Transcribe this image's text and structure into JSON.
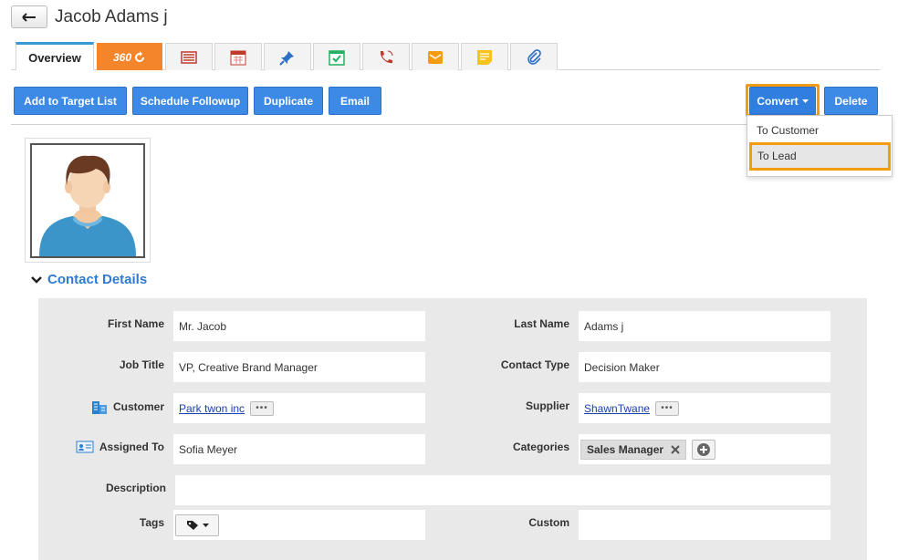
{
  "header": {
    "title": "Jacob Adams j"
  },
  "tabs": {
    "overview": "Overview",
    "t360": "360",
    "icons": [
      "invoice-icon",
      "calendar-icon",
      "pin-icon",
      "task-icon",
      "call-icon",
      "mail-icon",
      "note-icon",
      "attachment-icon"
    ]
  },
  "toolbar": {
    "add_to_target_list": "Add to Target List",
    "schedule_followup": "Schedule Followup",
    "duplicate": "Duplicate",
    "email": "Email",
    "convert": "Convert",
    "delete": "Delete"
  },
  "convert_menu": {
    "to_customer": "To Customer",
    "to_lead": "To Lead"
  },
  "section": {
    "title": "Contact Details"
  },
  "fields": {
    "first_name": {
      "label": "First Name",
      "value": "Mr. Jacob"
    },
    "last_name": {
      "label": "Last Name",
      "value": "Adams j"
    },
    "job_title": {
      "label": "Job Title",
      "value": "VP, Creative Brand Manager"
    },
    "contact_type": {
      "label": "Contact Type",
      "value": "Decision Maker"
    },
    "customer": {
      "label": "Customer",
      "value": "Park twon inc"
    },
    "supplier": {
      "label": "Supplier",
      "value": "ShawnTwane"
    },
    "assigned_to": {
      "label": "Assigned To",
      "value": "Sofia Meyer"
    },
    "categories": {
      "label": "Categories",
      "value": "Sales Manager"
    },
    "description": {
      "label": "Description",
      "value": ""
    },
    "tags": {
      "label": "Tags"
    },
    "custom": {
      "label": "Custom",
      "value": ""
    }
  },
  "colors": {
    "accent": "#3d8ae6",
    "highlight": "#f39c12",
    "tab360": "#f5852a"
  }
}
